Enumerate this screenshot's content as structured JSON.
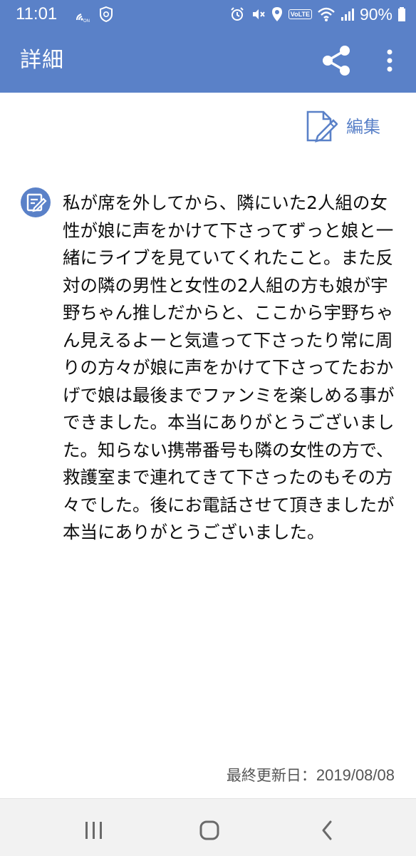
{
  "status_bar": {
    "time": "11:01",
    "volte": "VoLTE",
    "battery": "90%"
  },
  "app_bar": {
    "title": "詳細"
  },
  "edit": {
    "label": "編集"
  },
  "memo": {
    "text": "私が席を外してから、隣にいた2人組の女性が娘に声をかけて下さってずっと娘と一緒にライブを見ていてくれたこと。また反対の隣の男性と女性の2人組の方も娘が宇野ちゃん推しだからと、ここから宇野ちゃん見えるよーと気遣って下さったり常に周りの方々が娘に声をかけて下さってたおかげで娘は最後までファンミを楽しめる事ができました。本当にありがとうございました。知らない携帯番号も隣の女性の方で、救護室まで連れてきて下さったのもその方々でした。後にお電話させて頂きましたが本当にありがとうございました。"
  },
  "footer": {
    "updated_label": "最終更新日：",
    "updated_date": "2019/08/08"
  },
  "colors": {
    "accent": "#5a81c8",
    "nav_bg": "#f2f2f2"
  },
  "icons": {
    "share": "share-icon",
    "more": "more-vertical-icon",
    "edit": "edit-note-icon",
    "memo": "memo-icon",
    "recent": "recent-apps-icon",
    "home": "home-icon",
    "back": "back-icon"
  }
}
